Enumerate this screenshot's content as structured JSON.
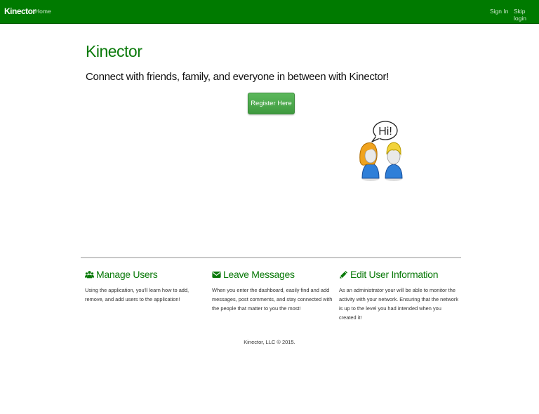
{
  "nav": {
    "brand": "Kinector",
    "home": "Home",
    "sign_in": "Sign In",
    "skip_login": "Skip login"
  },
  "hero": {
    "title": "Kinector",
    "subtitle": "Connect with friends, family, and everyone in between with Kinector!",
    "register_label": "Register Here",
    "speech_bubble": "Hi!"
  },
  "features": [
    {
      "icon": "users-icon",
      "title": "Manage Users",
      "text": "Using the application, you'll learn how to add, remove, and add users to the application!"
    },
    {
      "icon": "envelope-icon",
      "title": "Leave Messages",
      "text": "When you enter the dashboard, easily find and add messages, post comments, and stay connected with the people that matter to you the most!"
    },
    {
      "icon": "pencil-icon",
      "title": "Edit User Information",
      "text": "As an administrator your will be able to monitor the activity with your network. Ensuring that the network is up to the level you had intended when you created it!"
    }
  ],
  "footer": {
    "copyright": "Kinector, LLC © 2015."
  },
  "colors": {
    "navbar": "#007a00",
    "accent_green": "#0a7a0a",
    "button_green": "#4cae4c"
  }
}
